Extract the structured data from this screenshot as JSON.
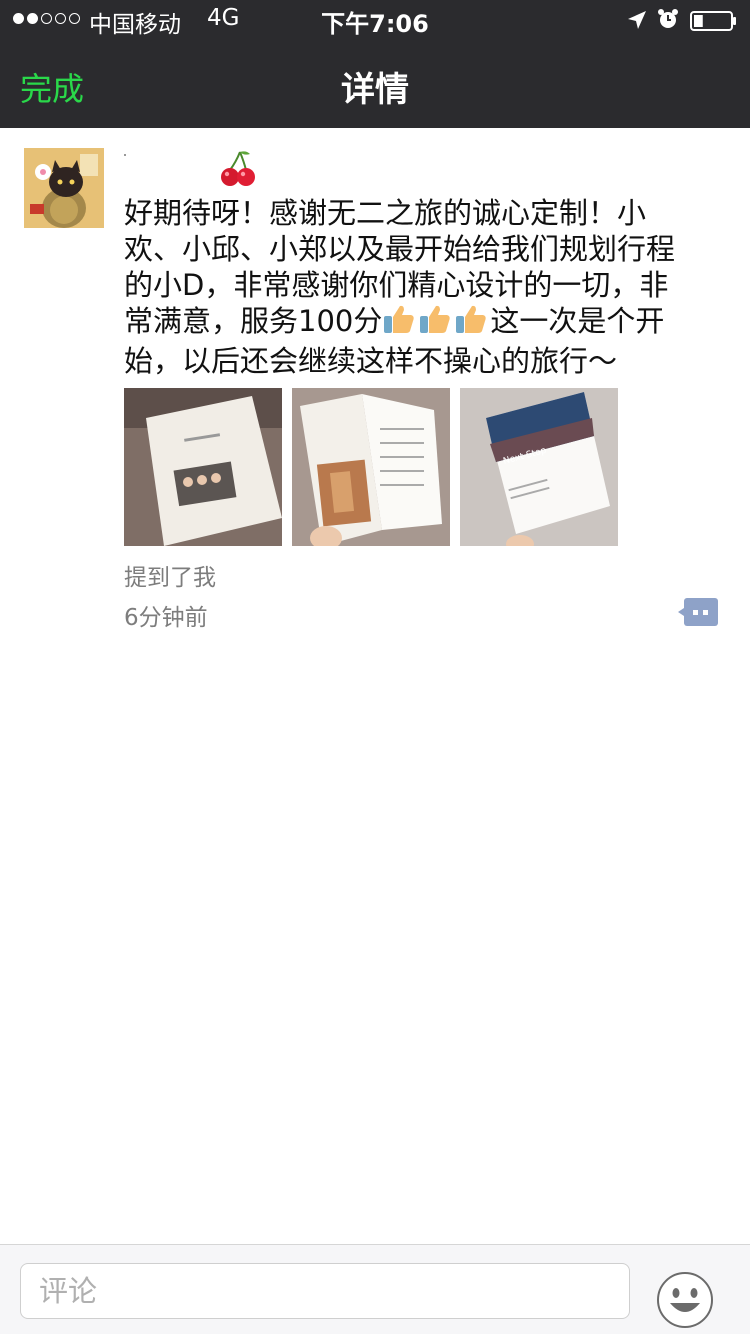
{
  "status_bar": {
    "carrier": "中国移动",
    "network": "4G",
    "time": "下午7:06",
    "signal_bars_filled": 2,
    "signal_bars_total": 5,
    "battery_level": 0.25
  },
  "nav": {
    "done_label": "完成",
    "title": "详情"
  },
  "post": {
    "lines": [
      "好期待呀！感谢无二之旅的诚心定制！小",
      "欢、小邱、小郑以及最开始给我们规划行程",
      "的小D，非常感谢你们精心设计的一切，非"
    ],
    "line4_before": "常满意，服务100分",
    "line4_after": "这一次是个开",
    "line5": "始，以后还会继续这样不操心的旅行～",
    "photo3_caption": "Next Stop",
    "mention_label": "提到了我",
    "time_label": "6分钟前"
  },
  "comment_bar": {
    "placeholder": "评论"
  },
  "colors": {
    "nav_bg": "#2b2b2e",
    "accent_green": "#2ad84a",
    "comment_icon": "#8ea2c8",
    "meta_text": "#7d7d7d"
  },
  "icons": {
    "location": "location-arrow-icon",
    "alarm": "alarm-clock-icon",
    "battery": "battery-icon",
    "cherry": "cherry-emoji-icon",
    "thumbs": "thumbs-up-emoji-icon",
    "comment": "comment-icon",
    "emoji": "smiley-icon"
  }
}
